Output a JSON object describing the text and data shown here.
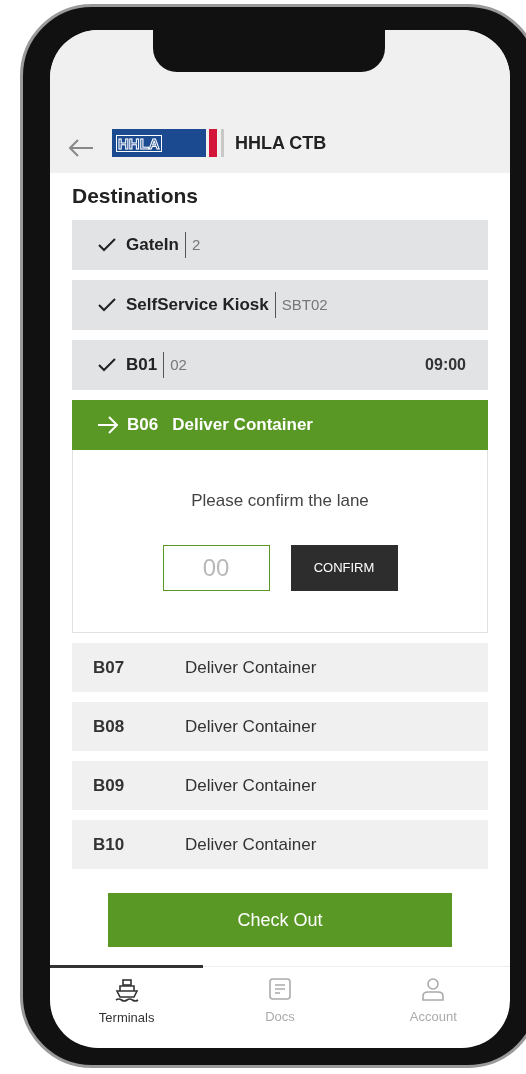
{
  "header": {
    "logo_text": "HHLA",
    "title": "HHLA CTB"
  },
  "section_title": "Destinations",
  "destinations": [
    {
      "kind": "done",
      "checked": true,
      "name": "GateIn",
      "detail": "2"
    },
    {
      "kind": "done",
      "checked": true,
      "name": "SelfService Kiosk",
      "detail": "SBT02"
    },
    {
      "kind": "done",
      "checked": true,
      "name": "B01",
      "detail": "02",
      "time": "09:00"
    },
    {
      "kind": "active",
      "code": "B06",
      "title": "Deliver Container",
      "prompt": "Please confirm the lane",
      "placeholder": "00",
      "button": "CONFIRM"
    },
    {
      "kind": "pending",
      "code": "B07",
      "title": "Deliver Container"
    },
    {
      "kind": "pending",
      "code": "B08",
      "title": "Deliver Container"
    },
    {
      "kind": "pending",
      "code": "B09",
      "title": "Deliver Container"
    },
    {
      "kind": "pending",
      "code": "B10",
      "title": "Deliver Container"
    }
  ],
  "checkout_button": "Check Out",
  "tabs": [
    {
      "kind": "ship",
      "label": "Terminals",
      "selected": true
    },
    {
      "kind": "doc",
      "label": "Docs",
      "selected": false
    },
    {
      "kind": "person",
      "label": "Account",
      "selected": false
    }
  ]
}
